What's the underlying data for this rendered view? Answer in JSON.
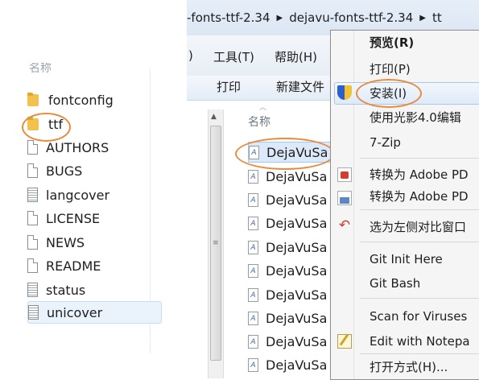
{
  "left_panel": {
    "header": "名称",
    "items": [
      {
        "label": "fontconfig",
        "type": "folder"
      },
      {
        "label": "ttf",
        "type": "folder"
      },
      {
        "label": "AUTHORS",
        "type": "file"
      },
      {
        "label": "BUGS",
        "type": "file"
      },
      {
        "label": "langcover",
        "type": "text"
      },
      {
        "label": "LICENSE",
        "type": "file"
      },
      {
        "label": "NEWS",
        "type": "file"
      },
      {
        "label": "README",
        "type": "file"
      },
      {
        "label": "status",
        "type": "text"
      },
      {
        "label": "unicover",
        "type": "text"
      }
    ]
  },
  "right_window": {
    "breadcrumb": {
      "segments": [
        "-fonts-ttf-2.34",
        "dejavu-fonts-ttf-2.34",
        "tt"
      ]
    },
    "menubar": {
      "items": [
        ")",
        "工具(T)",
        "帮助(H)"
      ]
    },
    "toolbar": {
      "print_label": "打印",
      "new_folder_label": "新建文件"
    },
    "column_header": "名称",
    "files": [
      "DejaVuSa",
      "DejaVuSa",
      "DejaVuSa",
      "DejaVuSa",
      "DejaVuSa",
      "DejaVuSa",
      "DejaVuSa",
      "DejaVuSa",
      "DejaVuSa",
      "DejaVuSa"
    ],
    "font_icon_glyph": "A"
  },
  "context_menu": {
    "items": [
      {
        "label": "预览(R)",
        "bold": true,
        "icon": ""
      },
      {
        "label": "打印(P)",
        "bold": false,
        "icon": ""
      },
      {
        "label": "安装(I)",
        "bold": false,
        "icon": "shield-icon"
      },
      {
        "label": "使用光影4.0编辑",
        "bold": false,
        "icon": ""
      },
      {
        "label": "7-Zip",
        "bold": false,
        "icon": ""
      },
      {
        "label": "转换为 Adobe PD",
        "bold": false,
        "icon": "pdf-icon"
      },
      {
        "label": "转换为 Adobe PD",
        "bold": false,
        "icon": "pdf-mail-icon"
      },
      {
        "label": "选为左侧对比窗口",
        "bold": false,
        "icon": "undo-icon"
      },
      {
        "label": "Git Init Here",
        "bold": false,
        "icon": ""
      },
      {
        "label": "Git Bash",
        "bold": false,
        "icon": ""
      },
      {
        "label": "Scan for Viruses",
        "bold": false,
        "icon": ""
      },
      {
        "label": "Edit with Notepa",
        "bold": false,
        "icon": "notepad-icon"
      },
      {
        "label": "打开方式(H)...",
        "bold": false,
        "icon": ""
      }
    ]
  },
  "colors": {
    "callout": "#e88b3d",
    "selection": "#dbe9fa",
    "folder": "#f1c24e"
  }
}
